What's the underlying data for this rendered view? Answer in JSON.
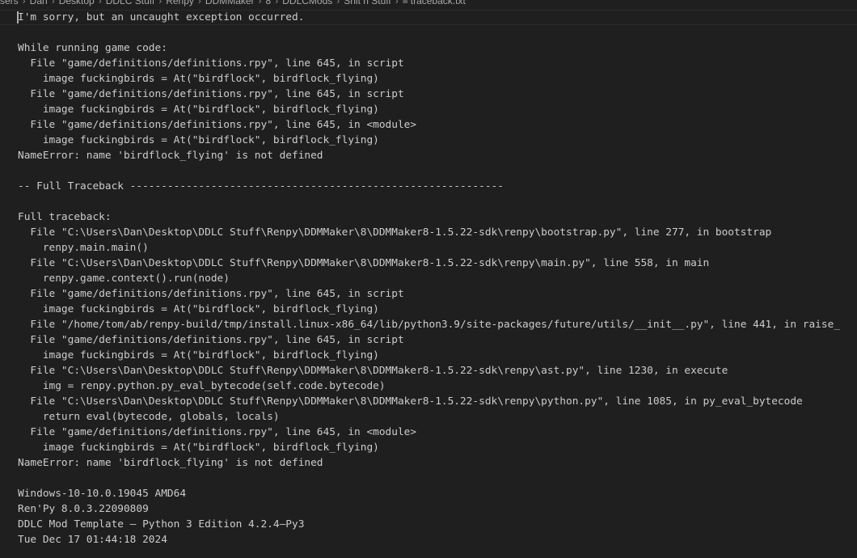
{
  "breadcrumb": {
    "items": [
      "sers",
      "Dan",
      "Desktop",
      "DDLC Stuff",
      "Renpy",
      "DDMMaker",
      "8",
      "DDLCMods",
      "Shit n Stuff"
    ],
    "file_icon": "lines-file-icon",
    "file_name": "traceback.txt"
  },
  "editor": {
    "lines": [
      "I'm sorry, but an uncaught exception occurred.",
      "",
      "While running game code:",
      "  File \"game/definitions/definitions.rpy\", line 645, in script",
      "    image fuckingbirds = At(\"birdflock\", birdflock_flying)",
      "  File \"game/definitions/definitions.rpy\", line 645, in script",
      "    image fuckingbirds = At(\"birdflock\", birdflock_flying)",
      "  File \"game/definitions/definitions.rpy\", line 645, in <module>",
      "    image fuckingbirds = At(\"birdflock\", birdflock_flying)",
      "NameError: name 'birdflock_flying' is not defined",
      "",
      "-- Full Traceback ------------------------------------------------------------",
      "",
      "Full traceback:",
      "  File \"C:\\Users\\Dan\\Desktop\\DDLC Stuff\\Renpy\\DDMMaker\\8\\DDMMaker8-1.5.22-sdk\\renpy\\bootstrap.py\", line 277, in bootstrap",
      "    renpy.main.main()",
      "  File \"C:\\Users\\Dan\\Desktop\\DDLC Stuff\\Renpy\\DDMMaker\\8\\DDMMaker8-1.5.22-sdk\\renpy\\main.py\", line 558, in main",
      "    renpy.game.context().run(node)",
      "  File \"game/definitions/definitions.rpy\", line 645, in script",
      "    image fuckingbirds = At(\"birdflock\", birdflock_flying)",
      "  File \"/home/tom/ab/renpy-build/tmp/install.linux-x86_64/lib/python3.9/site-packages/future/utils/__init__.py\", line 441, in raise_",
      "  File \"game/definitions/definitions.rpy\", line 645, in script",
      "    image fuckingbirds = At(\"birdflock\", birdflock_flying)",
      "  File \"C:\\Users\\Dan\\Desktop\\DDLC Stuff\\Renpy\\DDMMaker\\8\\DDMMaker8-1.5.22-sdk\\renpy\\ast.py\", line 1230, in execute",
      "    img = renpy.python.py_eval_bytecode(self.code.bytecode)",
      "  File \"C:\\Users\\Dan\\Desktop\\DDLC Stuff\\Renpy\\DDMMaker\\8\\DDMMaker8-1.5.22-sdk\\renpy\\python.py\", line 1085, in py_eval_bytecode",
      "    return eval(bytecode, globals, locals)",
      "  File \"game/definitions/definitions.rpy\", line 645, in <module>",
      "    image fuckingbirds = At(\"birdflock\", birdflock_flying)",
      "NameError: name 'birdflock_flying' is not defined",
      "",
      "Windows-10-10.0.19045 AMD64",
      "Ren'Py 8.0.3.22090809",
      "DDLC Mod Template – Python 3 Edition 4.2.4–Py3",
      "Tue Dec 17 01:44:18 2024"
    ]
  },
  "colors": {
    "background": "#1f1f1f",
    "text": "#cccccc",
    "breadcrumb_text": "#a9a9a9",
    "cursor": "#aeafad"
  }
}
